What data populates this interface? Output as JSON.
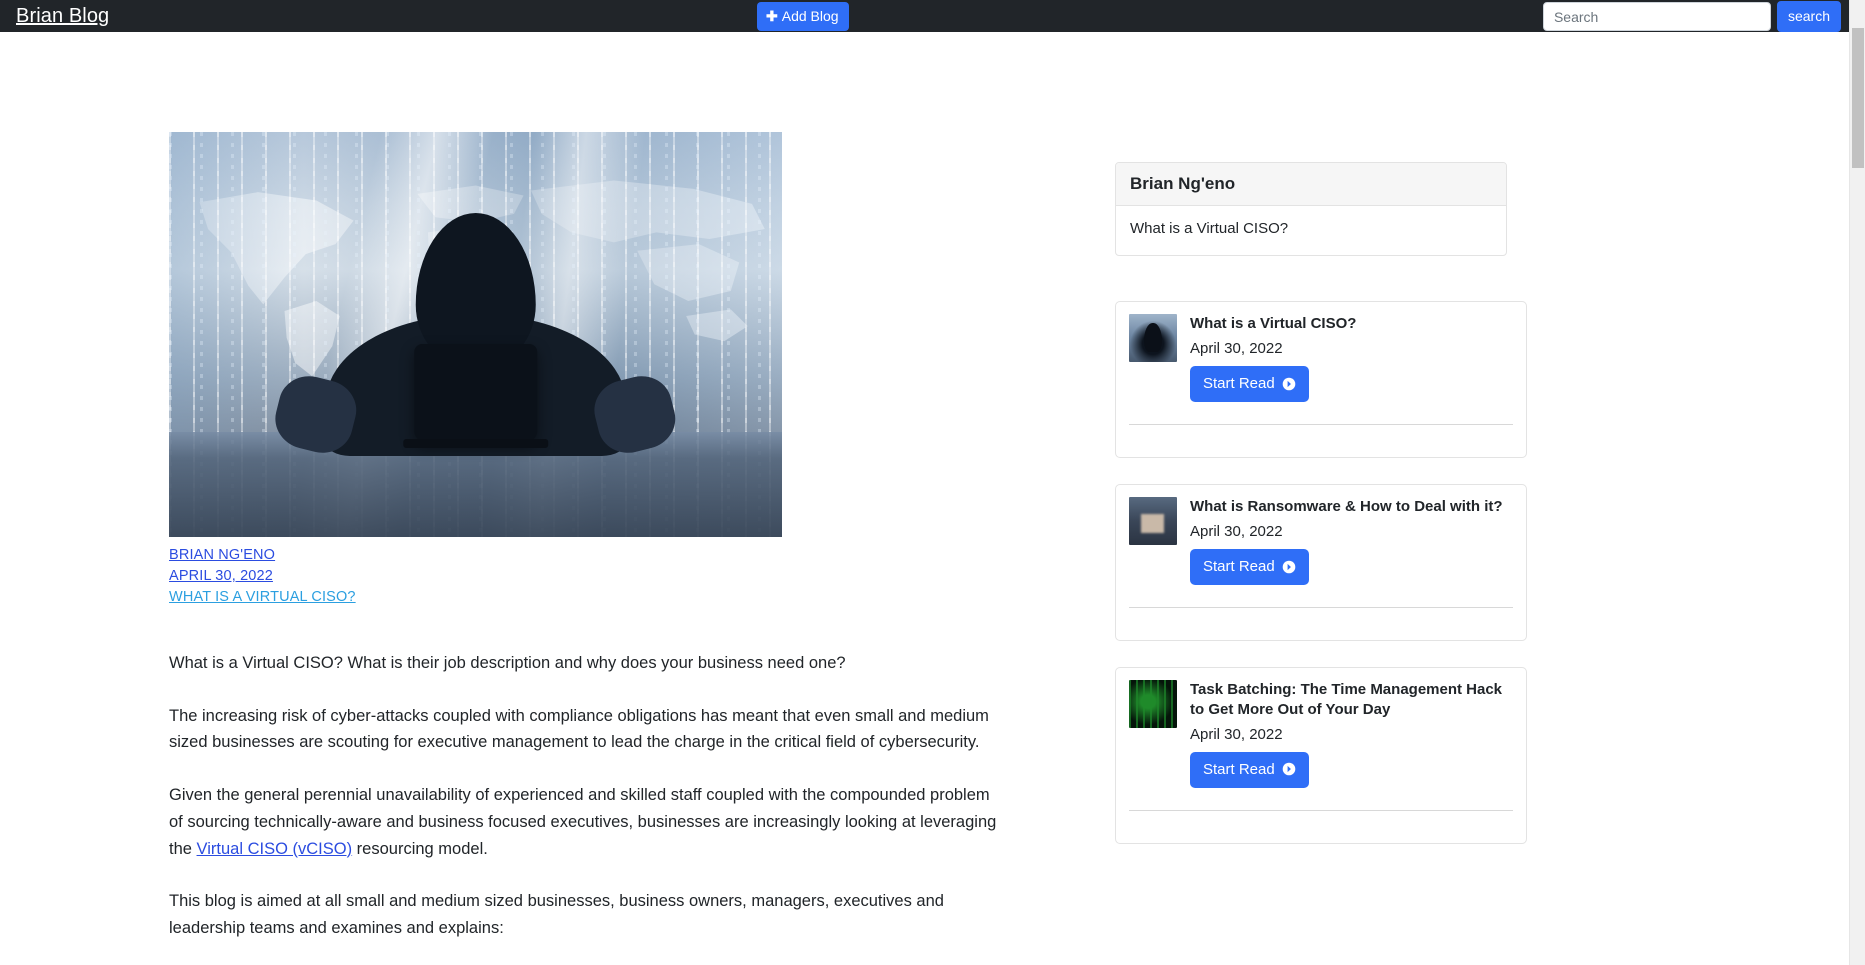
{
  "navbar": {
    "brand": "Brian Blog",
    "add_blog_label": "Add Blog",
    "add_blog_icon": "plus-icon",
    "search_placeholder": "Search",
    "search_value": "",
    "search_button_label": "search",
    "background_color": "#212529",
    "accent_color": "#2f6ef7"
  },
  "article": {
    "hero_image_alt": "Hooded hacker at a laptop over a world map with binary code",
    "meta": {
      "author": "BRIAN NG'ENO",
      "date": "APRIL 30, 2022",
      "title": "WHAT IS A VIRTUAL CISO?",
      "author_color": "#2b4ce0",
      "date_color": "#2b4ce0",
      "title_color": "#2b9fe0"
    },
    "paragraphs": [
      "What is a Virtual CISO? What is their job description and why does your business need one?",
      "The increasing risk of cyber-attacks coupled with compliance obligations has meant that even small and medium sized businesses are scouting for executive management to lead the charge in the critical field of cybersecurity.",
      "This blog is aimed at all small and medium sized businesses, business owners, managers, executives and leadership teams and examines and explains:"
    ],
    "linked_paragraph": {
      "before": "Given the general perennial unavailability of experienced and skilled staff coupled with the compounded problem of sourcing technically-aware and business focused executives, businesses are increasingly looking at leveraging the ",
      "link_text": "Virtual CISO (vCISO)",
      "after": " resourcing model."
    }
  },
  "sidebar": {
    "author_card": {
      "header": "Brian Ng'eno",
      "body": "What is a Virtual CISO?"
    },
    "posts": [
      {
        "title": "What is a Virtual CISO?",
        "date": "April 30, 2022",
        "button_label": "Start Read",
        "button_icon": "arrow-right-circle-icon",
        "thumbnail": "hacker-thumbnail"
      },
      {
        "title": "What is Ransomware & How to Deal with it?",
        "date": "April 30, 2022",
        "button_label": "Start Read",
        "button_icon": "arrow-right-circle-icon",
        "thumbnail": "ransomware-thumbnail"
      },
      {
        "title": "Task Batching: The Time Management Hack to Get More Out of Your Day",
        "date": "April 30, 2022",
        "button_label": "Start Read",
        "button_icon": "arrow-right-circle-icon",
        "thumbnail": "matrix-thumbnail"
      }
    ]
  }
}
